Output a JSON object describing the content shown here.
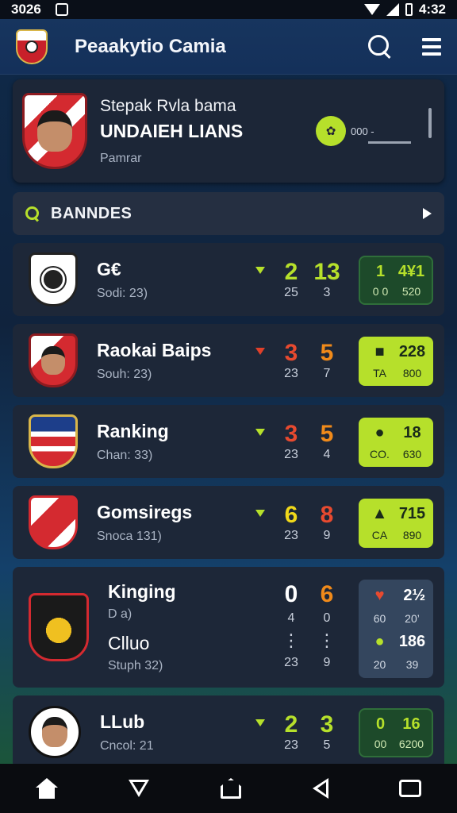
{
  "status_bar": {
    "time_left": "3026",
    "time_right": "4:32"
  },
  "app_bar": {
    "title": "Peaakytio Camia"
  },
  "profile": {
    "line1": "Stepak Rvla bama",
    "line2": "UNDAIEH LIANS",
    "line3": "Pamrar",
    "badge_text": "000 -"
  },
  "banner": {
    "label": "BANNDES"
  },
  "rows": [
    {
      "name": "G€",
      "sub": "Sodi:  23)",
      "arrow_color": "#b6e02b",
      "score_a": "2",
      "score_a_color": "#b6e02b",
      "score_b": "13",
      "score_b_color": "#b6e02b",
      "small_a": "25",
      "small_b": "3",
      "stat_style": "dark",
      "stat": [
        "1",
        "4¥1",
        "0 0",
        "520"
      ]
    },
    {
      "name": "Raokai Baips",
      "sub": "Souh:  23)",
      "arrow_color": "#e0402a",
      "score_a": "3",
      "score_a_color": "#e84a2f",
      "score_b": "5",
      "score_b_color": "#f08a1a",
      "small_a": "23",
      "small_b": "7",
      "stat_style": "lime",
      "stat": [
        "■",
        "228",
        "TA",
        "800"
      ]
    },
    {
      "name": "Ranking",
      "sub": "Chan:  33)",
      "arrow_color": "#b6e02b",
      "score_a": "3",
      "score_a_color": "#e84a2f",
      "score_b": "5",
      "score_b_color": "#f08a1a",
      "small_a": "23",
      "small_b": "4",
      "stat_style": "lime",
      "stat": [
        "●",
        "18",
        "CO.",
        "630"
      ]
    },
    {
      "name": "Gomsiregs",
      "sub": "Snoca  131)",
      "arrow_color": "#b6e02b",
      "score_a": "6",
      "score_a_color": "#f0d81a",
      "score_b": "8",
      "score_b_color": "#e84a2f",
      "small_a": "23",
      "small_b": "9",
      "stat_style": "lime",
      "stat": [
        "▲",
        "715",
        "CA",
        "890"
      ]
    }
  ],
  "tall_row": {
    "name": "Kinging",
    "sub1": "D a)",
    "name2": "Clluo",
    "sub2": "Stuph  32)",
    "score_a": "0",
    "score_b": "6",
    "mid_a": "4",
    "mid_b": "0",
    "small_a": "23",
    "small_b": "9",
    "stat": [
      "♥",
      " 2½",
      "60",
      "20’",
      "●",
      "186",
      "20",
      "39"
    ]
  },
  "last_row": {
    "name": "LLub",
    "sub": "Cncol:  21",
    "score_a": "2",
    "score_b": "3",
    "small_a": "23",
    "small_b": "5",
    "stat": [
      "0",
      "16",
      "00",
      "6200"
    ]
  }
}
